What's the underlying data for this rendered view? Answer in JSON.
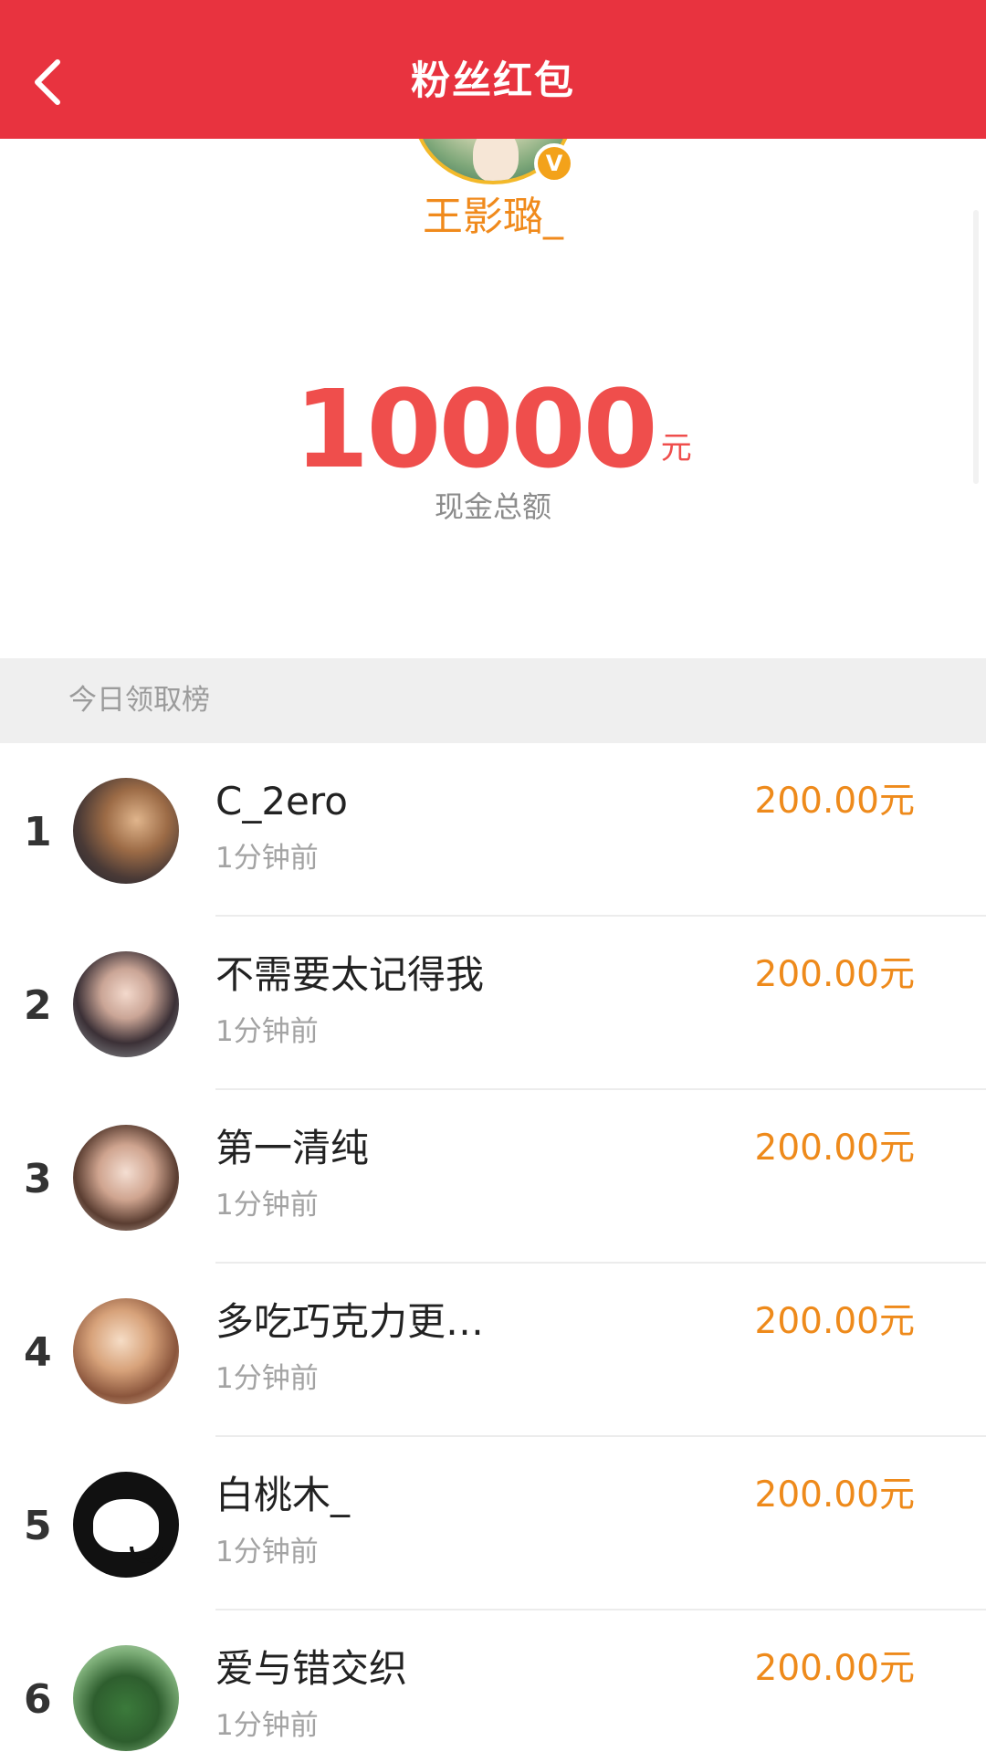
{
  "header": {
    "title": "粉丝红包",
    "back_icon": "chevron-left-icon"
  },
  "profile": {
    "name": "王影璐_",
    "badge": "V"
  },
  "amount": {
    "value": "10000",
    "unit": "元",
    "label": "现金总额"
  },
  "colors": {
    "header_bg": "#e8333f",
    "amount": "#ef4e4c",
    "accent": "#ee8a1b"
  },
  "section": {
    "title": "今日领取榜"
  },
  "ranking": [
    {
      "rank": "1",
      "name": "C_2ero",
      "time": "1分钟前",
      "amount": "200.00元"
    },
    {
      "rank": "2",
      "name": "不需要太记得我",
      "time": "1分钟前",
      "amount": "200.00元"
    },
    {
      "rank": "3",
      "name": "第一清纯",
      "time": "1分钟前",
      "amount": "200.00元"
    },
    {
      "rank": "4",
      "name": "多吃巧克力更…",
      "time": "1分钟前",
      "amount": "200.00元"
    },
    {
      "rank": "5",
      "name": "白桃木_",
      "time": "1分钟前",
      "amount": "200.00元"
    },
    {
      "rank": "6",
      "name": "爱与错交织",
      "time": "1分钟前",
      "amount": "200.00元"
    }
  ]
}
